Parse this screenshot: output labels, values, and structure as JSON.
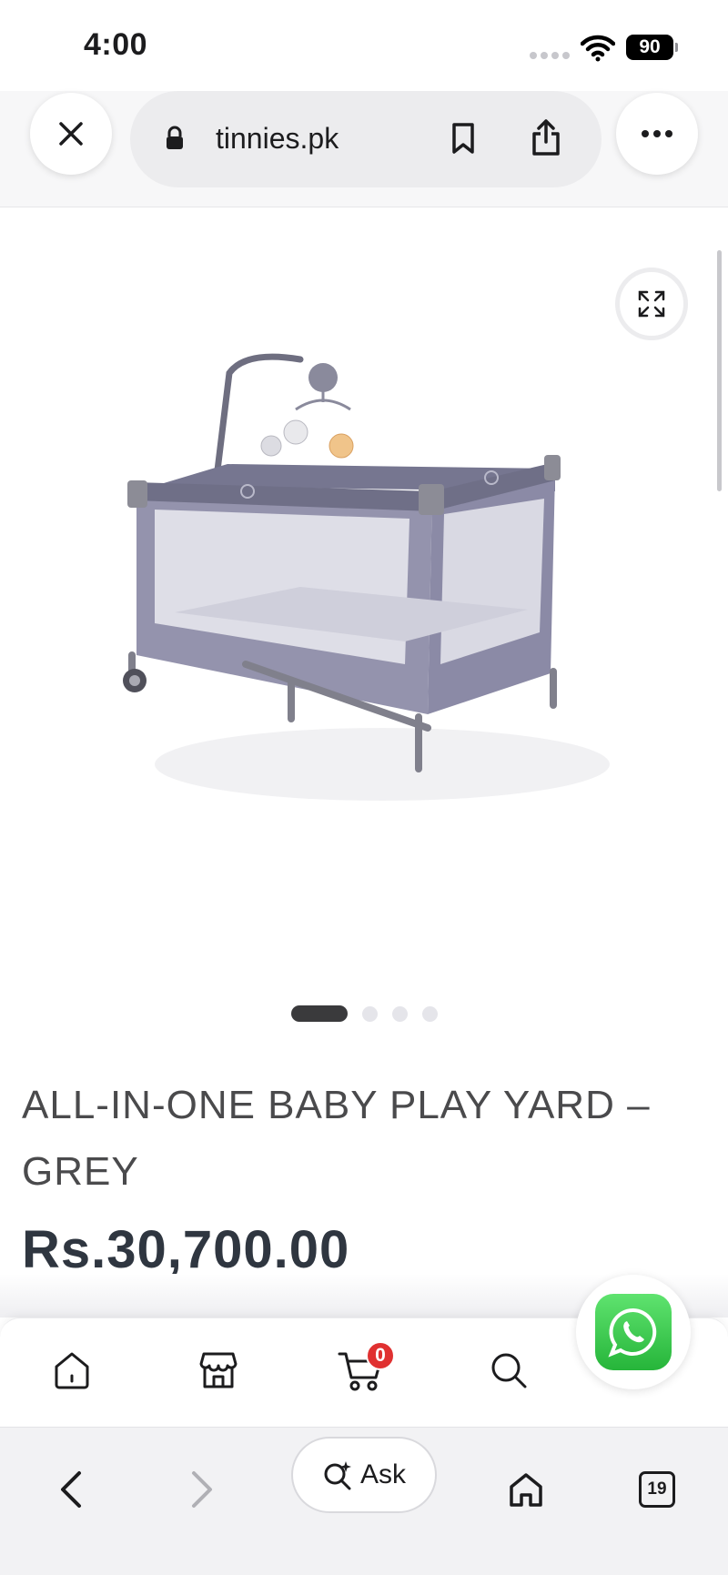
{
  "status_bar": {
    "time": "4:00",
    "battery": "90"
  },
  "browser": {
    "url": "tinnies.pk",
    "ask_label": "Ask",
    "tab_count": "19"
  },
  "product": {
    "title": "ALL-IN-ONE BABY PLAY YARD – GREY",
    "price": "Rs.30,700.00",
    "carousel_total": 4,
    "carousel_active": 1
  },
  "site_nav": {
    "cart_count": "0",
    "items": [
      "home-icon",
      "store-icon",
      "cart-icon",
      "search-icon"
    ]
  },
  "colors": {
    "title_text": "#4a4a4c",
    "price_text": "#2f3640",
    "badge_red": "#e03131",
    "whatsapp_green": "#26b53a",
    "crib_fabric": "#8b8aa6"
  }
}
